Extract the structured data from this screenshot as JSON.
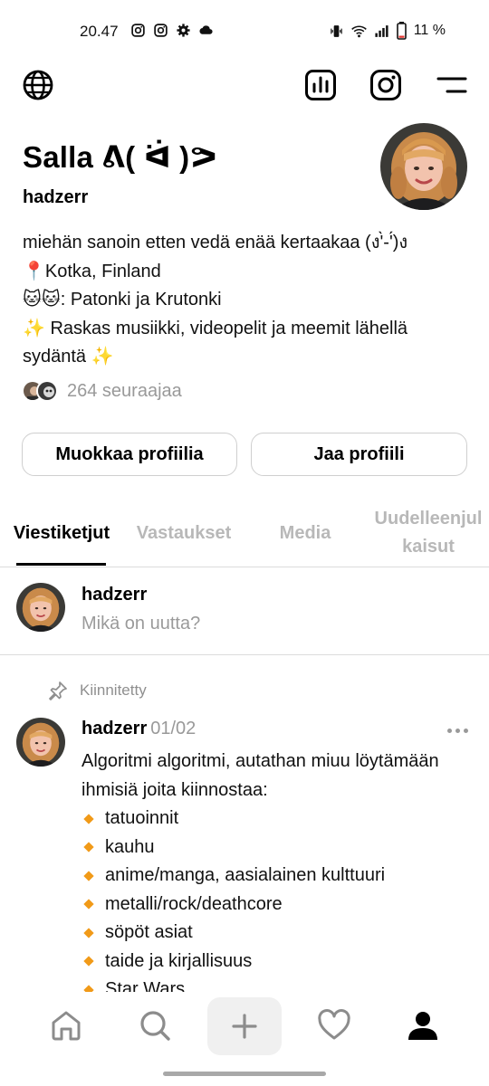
{
  "status_bar": {
    "time": "20.47",
    "battery": "11 %",
    "icons": [
      "instagram-icon",
      "instagram-icon",
      "gear-icon",
      "cloud-icon",
      "vibrate-icon",
      "wifi-icon",
      "signal-icon",
      "battery-icon"
    ]
  },
  "top_nav": {
    "icons": [
      "globe-icon",
      "bar-chart-icon",
      "instagram-icon",
      "menu-icon"
    ]
  },
  "profile": {
    "name": "Salla ᕕ( ᐛ )ᕗ",
    "handle": "hadzerr",
    "bio": [
      "miehän sanoin etten vedä enää kertaakaa (ง'̀-'́)ง",
      "📍Kotka, Finland",
      "🐱🐱: Patonki ja Krutonki",
      "✨ Raskas musiikki, videopelit ja meemit lähellä sydäntä ✨"
    ],
    "followers_text": "264 seuraajaa",
    "edit_button": "Muokkaa profiilia",
    "share_button": "Jaa profiili"
  },
  "tabs": [
    {
      "label": "Viestiketjut",
      "active": true
    },
    {
      "label": "Vastaukset",
      "active": false
    },
    {
      "label": "Media",
      "active": false
    },
    {
      "label": "Uudelleenjulkaisut",
      "active": false
    }
  ],
  "composer": {
    "username": "hadzerr",
    "placeholder": "Mikä on uutta?"
  },
  "post": {
    "pinned_label": "Kiinnitetty",
    "username": "hadzerr",
    "date": "01/02",
    "intro": "Algoritmi algoritmi, autathan miuu löytämään ihmisiä joita kiinnostaa:",
    "items": [
      "tatuoinnit",
      "kauhu",
      "anime/manga, aasialainen kulttuuri",
      "metalli/rock/deathcore",
      "söpöt asiat",
      "taide ja kirjallisuus",
      "Star Wars"
    ],
    "bullet_color": "#f19a18"
  },
  "bottom_nav": {
    "icons": [
      "home-icon",
      "search-icon",
      "plus-icon",
      "heart-icon",
      "profile-icon"
    ]
  }
}
